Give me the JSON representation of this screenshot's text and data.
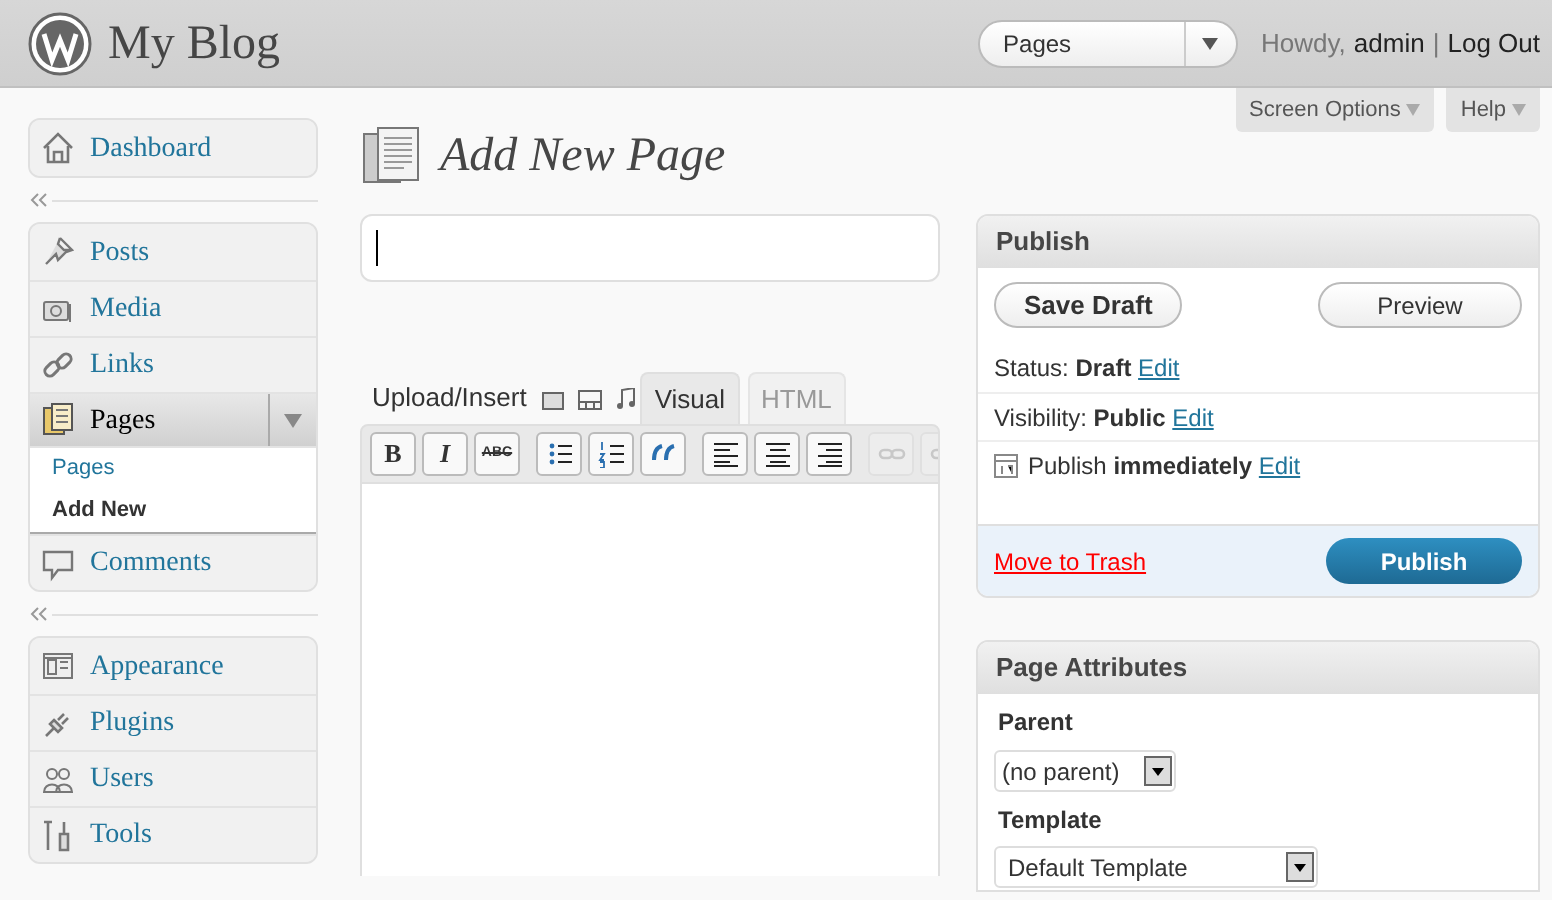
{
  "header": {
    "site_title": "My Blog",
    "quick_menu": {
      "value": "Pages"
    },
    "greeting": "Howdy,",
    "user": "admin",
    "separator": "|",
    "logout": "Log Out"
  },
  "screen_tabs": [
    {
      "label": "Screen Options"
    },
    {
      "label": "Help"
    }
  ],
  "sidebar": {
    "groups": [
      {
        "items": [
          {
            "label": "Dashboard",
            "current": false
          }
        ]
      },
      {
        "items": [
          {
            "label": "Posts",
            "current": false
          },
          {
            "label": "Media",
            "current": false
          },
          {
            "label": "Links",
            "current": false
          },
          {
            "label": "Pages",
            "current": true,
            "expanded": true,
            "children": [
              {
                "label": "Pages",
                "selected": false
              },
              {
                "label": "Add New",
                "selected": true
              }
            ]
          },
          {
            "label": "Comments",
            "current": false
          }
        ]
      },
      {
        "items": [
          {
            "label": "Appearance",
            "current": false
          },
          {
            "label": "Plugins",
            "current": false
          },
          {
            "label": "Users",
            "current": false
          },
          {
            "label": "Tools",
            "current": false
          }
        ]
      }
    ]
  },
  "page_title": "Add New Page",
  "editor": {
    "upload_label": "Upload/Insert",
    "tabs": [
      {
        "label": "Visual",
        "selected": true
      },
      {
        "label": "HTML",
        "selected": false
      }
    ],
    "toolbar": [
      {
        "label": "B",
        "disabled": false
      },
      {
        "label": "I",
        "disabled": false
      },
      {
        "label": "ABC",
        "disabled": false
      },
      {
        "disabled": false
      },
      {
        "disabled": false
      },
      {
        "disabled": false
      },
      {
        "disabled": false
      },
      {
        "disabled": false
      },
      {
        "disabled": false
      },
      {
        "disabled": true
      },
      {
        "disabled": true
      }
    ]
  },
  "publish": {
    "title": "Publish",
    "save_draft": "Save Draft",
    "preview": "Preview",
    "rows": [
      {
        "kind": "text",
        "text": "Status: **Draft**",
        "link": "Edit"
      },
      {
        "kind": "text",
        "text": "Visibility: **Public**",
        "link": "Edit"
      },
      {
        "kind": "date",
        "text": "Publish **immediately**",
        "link": "Edit"
      }
    ],
    "trash": "Move to Trash",
    "publish_button": "Publish"
  },
  "page_attributes": {
    "title": "Page Attributes",
    "parent_label": "Parent",
    "parent_value": "(no parent)",
    "template_label": "Template",
    "template_value": "Default Template"
  }
}
